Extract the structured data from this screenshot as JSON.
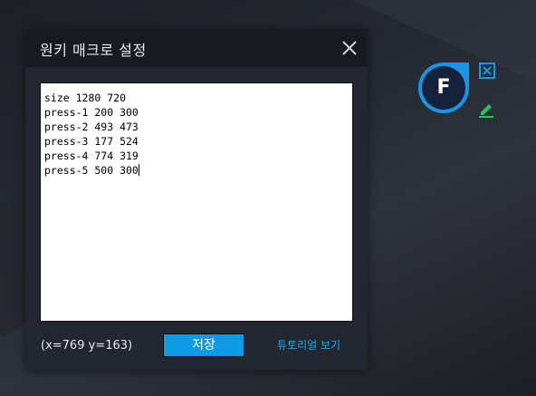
{
  "dialog": {
    "title": "원키 매크로 설정",
    "editor_lines": [
      "size 1280 720",
      "press-1 200 300",
      "press-2 493 473",
      "press-3 177 524",
      "press-4 774 319",
      "press-5 500 300"
    ],
    "coords_text": "(x=769  y=163)",
    "save_label": "저장",
    "tutorial_label": "튜토리얼 보기"
  },
  "key_widget": {
    "letter": "F"
  },
  "colors": {
    "accent": "#0e9be6",
    "link": "#1ea8f0",
    "edit_icon": "#22c55e"
  },
  "icons": [
    "close-icon",
    "remove-icon",
    "edit-icon"
  ]
}
